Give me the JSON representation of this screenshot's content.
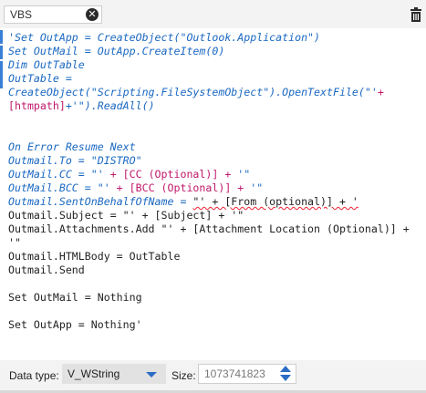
{
  "header": {
    "name_value": "VBS",
    "clear_icon": "close-circle-icon",
    "delete_icon": "trash-icon"
  },
  "editor": {
    "lines": [
      {
        "segments": [
          {
            "t": "'Set OutApp = CreateObject(\"Outlook.Application\")",
            "s": "c"
          }
        ]
      },
      {
        "segments": [
          {
            "t": "Set OutMail = OutApp.CreateItem(0)",
            "s": "c"
          }
        ]
      },
      {
        "segments": [
          {
            "t": "Dim OutTable",
            "s": "c"
          }
        ]
      },
      {
        "segments": [
          {
            "t": "OutTable =",
            "s": "c"
          }
        ]
      },
      {
        "segments": [
          {
            "t": "CreateObject(\"Scripting.FileSystemObject\").OpenTextFile(\"'",
            "s": "c"
          },
          {
            "t": "+",
            "s": "p"
          }
        ]
      },
      {
        "segments": [
          {
            "t": "[htmpath]",
            "s": "p"
          },
          {
            "t": "+'\").ReadAll()",
            "s": "c"
          }
        ]
      },
      {
        "segments": []
      },
      {
        "segments": []
      },
      {
        "segments": [
          {
            "t": "On Error Resume Next",
            "s": "c"
          }
        ]
      },
      {
        "segments": [
          {
            "t": "Outmail.To = \"DISTRO\"",
            "s": "c"
          }
        ]
      },
      {
        "segments": [
          {
            "t": "OutMail.CC = \"' ",
            "s": "c"
          },
          {
            "t": "+ [CC (Optional)] +",
            "s": "p"
          },
          {
            "t": " '\"",
            "s": "c"
          }
        ]
      },
      {
        "segments": [
          {
            "t": "OutMail.BCC = \"' ",
            "s": "c"
          },
          {
            "t": "+ [BCC (Optional)] +",
            "s": "p"
          },
          {
            "t": " '\"",
            "s": "c"
          }
        ]
      },
      {
        "segments": [
          {
            "t": "Outmail.SentOnBehalfOfName = ",
            "s": "c"
          },
          {
            "t": "\"' + [From (optional)] + '",
            "s": "k",
            "sq": true
          }
        ]
      },
      {
        "segments": [
          {
            "t": "Outmail.Subject = \"' + [Subject] + '\"",
            "s": "k"
          }
        ]
      },
      {
        "segments": [
          {
            "t": "Outmail.Attachments.Add \"' + [Attachment Location (Optional)] +",
            "s": "k"
          }
        ]
      },
      {
        "segments": [
          {
            "t": "'\"",
            "s": "k"
          }
        ]
      },
      {
        "segments": [
          {
            "t": "Outmail.HTMLBody = OutTable",
            "s": "k"
          }
        ]
      },
      {
        "segments": [
          {
            "t": "Outmail.Send",
            "s": "k"
          }
        ]
      },
      {
        "segments": []
      },
      {
        "segments": [
          {
            "t": "Set OutMail = Nothing",
            "s": "k"
          }
        ]
      },
      {
        "segments": []
      },
      {
        "segments": [
          {
            "t": "Set OutApp = Nothing'",
            "s": "k"
          }
        ]
      }
    ]
  },
  "footer": {
    "data_type_label": "Data type:",
    "data_type_value": "V_WString",
    "size_label": "Size:",
    "size_value": "1073741823"
  },
  "colors": {
    "comment": "#1a68c1",
    "param": "#c0186b",
    "text": "#222222",
    "accent": "#2b6cc4"
  }
}
